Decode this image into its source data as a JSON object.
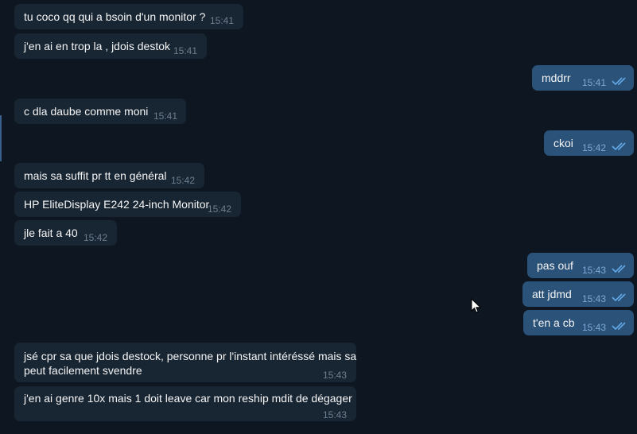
{
  "conversation": {
    "messages": [
      {
        "direction": "in",
        "text": "tu coco qq qui a bsoin d'un monitor ?",
        "time": "15:41"
      },
      {
        "direction": "in",
        "text": "j'en ai en trop la , jdois destok",
        "time": "15:41"
      },
      {
        "direction": "out",
        "text": "mddrr",
        "time": "15:41",
        "status_icon": "double-check-icon"
      },
      {
        "direction": "in",
        "text": "c dla daube comme moni",
        "time": "15:41"
      },
      {
        "direction": "out",
        "text": "ckoi",
        "time": "15:42",
        "status_icon": "double-check-icon"
      },
      {
        "direction": "in",
        "text": "mais sa suffit pr tt en général",
        "time": "15:42"
      },
      {
        "direction": "in",
        "text": "HP EliteDisplay E242 24-inch Monitor",
        "time": "15:42"
      },
      {
        "direction": "in",
        "text": "jle fait a 40",
        "time": "15:42"
      },
      {
        "direction": "out",
        "text": "pas ouf",
        "time": "15:43",
        "status_icon": "double-check-icon"
      },
      {
        "direction": "out",
        "text": "att jdmd",
        "time": "15:43",
        "status_icon": "double-check-icon"
      },
      {
        "direction": "out",
        "text": "t'en a cb",
        "time": "15:43",
        "status_icon": "double-check-icon"
      },
      {
        "direction": "in",
        "text_line1": "jsé cpr sa que jdois destock, personne pr l'instant intéréssé mais sa",
        "text_line2": "peut facilement svendre",
        "time": "15:43"
      },
      {
        "direction": "in",
        "text": "j'en ai genre 10x mais 1 doit leave car mon reship mdit de dégager",
        "time": "15:43"
      }
    ]
  },
  "colors": {
    "background": "#0e1621",
    "incoming_bubble": "#182533",
    "outgoing_bubble": "#2b5278",
    "read_check": "#63a9e8",
    "text": "#f5f5f5"
  },
  "icons": [
    "double-check-icon",
    "mouse-pointer-icon"
  ]
}
